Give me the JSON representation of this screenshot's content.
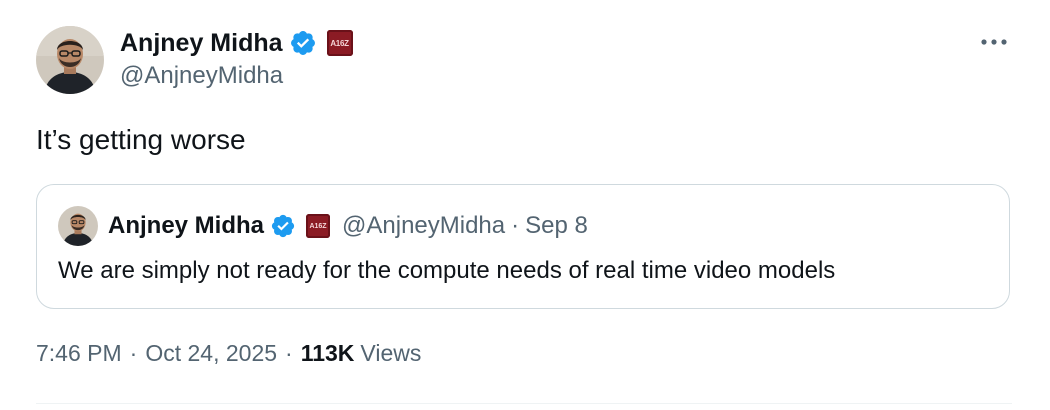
{
  "author": {
    "name": "Anjney Midha",
    "handle": "@AnjneyMidha",
    "affiliate_badge_text": "A16Z"
  },
  "tweet": {
    "text": "It’s getting worse",
    "time": "7:46 PM",
    "date": "Oct 24, 2025",
    "separator": "·",
    "views_count": "113K",
    "views_label": "Views"
  },
  "quoted_tweet": {
    "name": "Anjney Midha",
    "handle": "@AnjneyMidha",
    "separator": "·",
    "date": "Sep 8",
    "text": "We are simply not ready for the compute needs of real time video models"
  },
  "colors": {
    "verified_blue": "#1d9bf0",
    "text_primary": "#0f1419",
    "text_secondary": "#536471",
    "border": "#cfd9de",
    "affiliate_badge": "#8b1b24"
  },
  "icons": {
    "verified": "verified-badge-icon",
    "more": "more-options-icon",
    "affiliate": "affiliate-badge-icon"
  }
}
